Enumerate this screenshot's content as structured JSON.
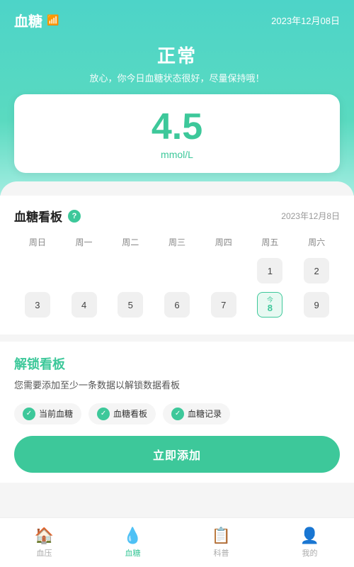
{
  "header": {
    "title": "血糖",
    "date": "2023年12月08日",
    "wifi_icon": "📶"
  },
  "hero": {
    "status_label": "正常",
    "status_desc": "放心，你今日血糖状态很好，尽量保持哦！"
  },
  "value_card": {
    "number": "4.5",
    "unit": "mmol/L"
  },
  "board": {
    "title": "血糖看板",
    "help": "?",
    "date": "2023年12月8日",
    "day_names": [
      "周日",
      "周一",
      "周二",
      "周三",
      "周四",
      "周五",
      "周六"
    ],
    "rows": [
      [
        {
          "label": "",
          "empty": true
        },
        {
          "label": "",
          "empty": true
        },
        {
          "label": "",
          "empty": true
        },
        {
          "label": "",
          "empty": true
        },
        {
          "label": "",
          "empty": true
        },
        {
          "label": "1",
          "empty": false
        },
        {
          "label": "2",
          "empty": false
        }
      ],
      [
        {
          "label": "3",
          "empty": false
        },
        {
          "label": "4",
          "empty": false
        },
        {
          "label": "5",
          "empty": false
        },
        {
          "label": "6",
          "empty": false
        },
        {
          "label": "7",
          "empty": false
        },
        {
          "label": "8",
          "today": true
        },
        {
          "label": "9",
          "empty": false
        }
      ]
    ]
  },
  "unlock": {
    "title": "解锁看板",
    "desc": "您需要添加至少一条数据以解锁数据看板",
    "badges": [
      {
        "label": "当前血糖"
      },
      {
        "label": "血糖看板"
      },
      {
        "label": "血糖记录"
      }
    ],
    "add_btn": "立即添加"
  },
  "bottom_nav": {
    "items": [
      {
        "label": "血压",
        "icon": "🏠",
        "active": false
      },
      {
        "label": "血糖",
        "icon": "💧",
        "active": true
      },
      {
        "label": "科普",
        "icon": "📋",
        "active": false
      },
      {
        "label": "我的",
        "icon": "👤",
        "active": false
      }
    ]
  }
}
